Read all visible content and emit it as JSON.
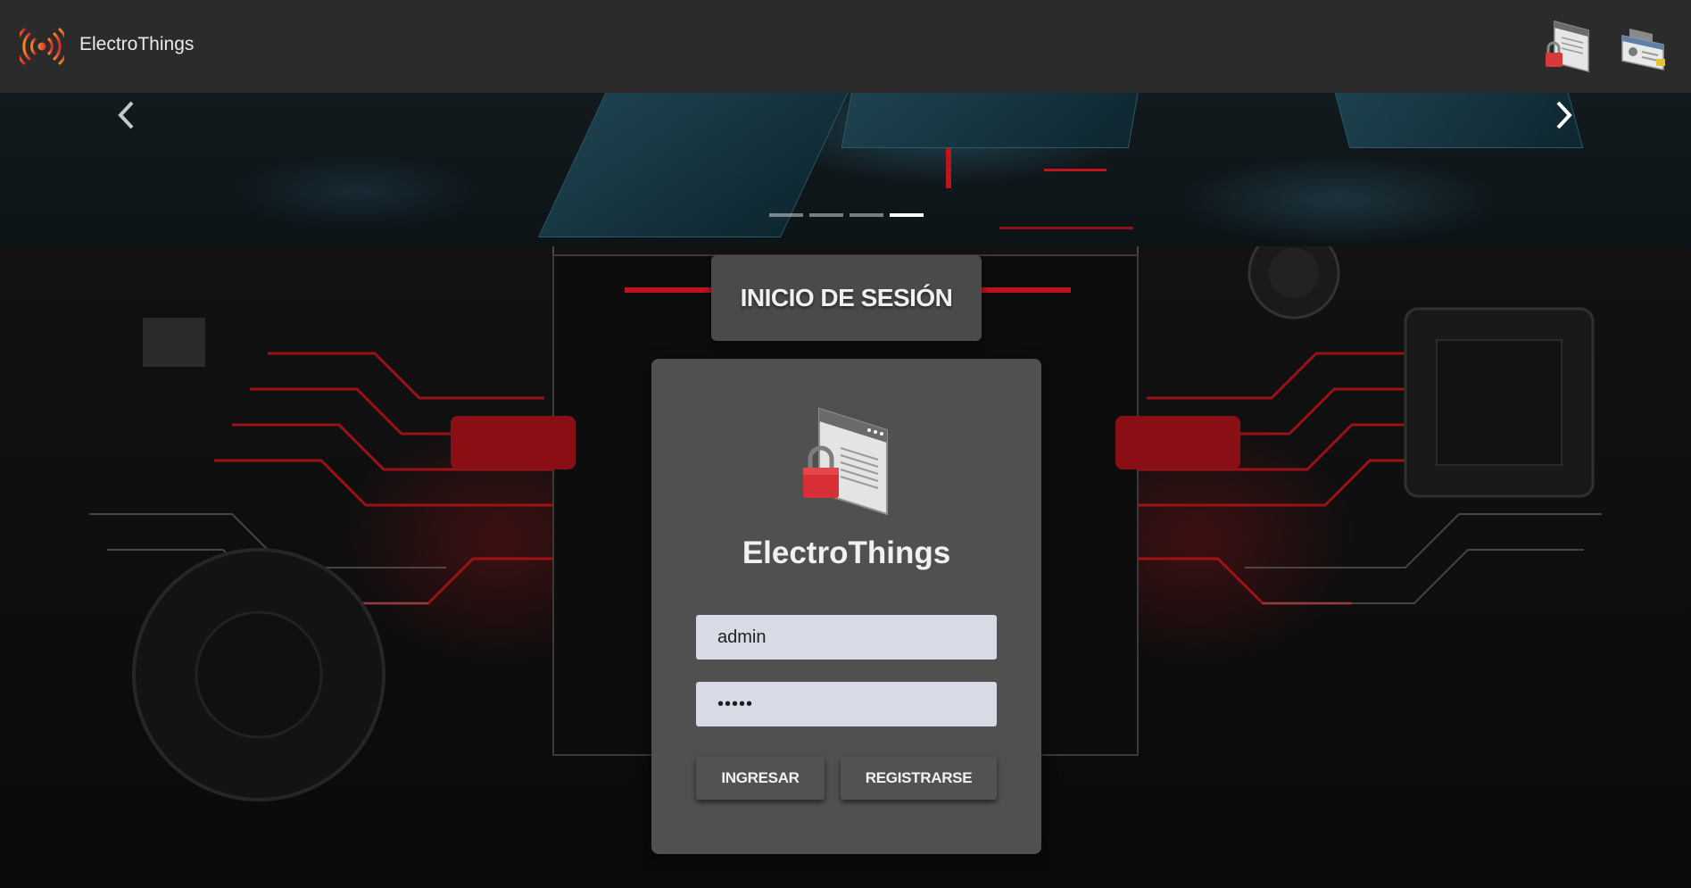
{
  "navbar": {
    "brand_name": "ElectroThings",
    "icons": {
      "brand": "broadcast-signal-icon",
      "login": "lock-window-icon",
      "register": "id-card-icon"
    }
  },
  "carousel": {
    "slides_count": 4,
    "active_slide": 4,
    "prev_icon": "chevron-left-icon",
    "next_icon": "chevron-right-icon"
  },
  "login": {
    "title": "INICIO DE SESIÓN",
    "brand_name": "ElectroThings",
    "illustration": "lock-window-icon",
    "username": {
      "value": "admin"
    },
    "password": {
      "value": "admin"
    },
    "buttons": {
      "login_label": "INGRESAR",
      "register_label": "REGISTRARSE"
    }
  },
  "colors": {
    "navbar_bg": "#2b2b2b",
    "card_bg": "#505050",
    "input_bg": "#d6dbe6",
    "accent_red": "#c0141c",
    "brand_orange": "#e8622a"
  }
}
